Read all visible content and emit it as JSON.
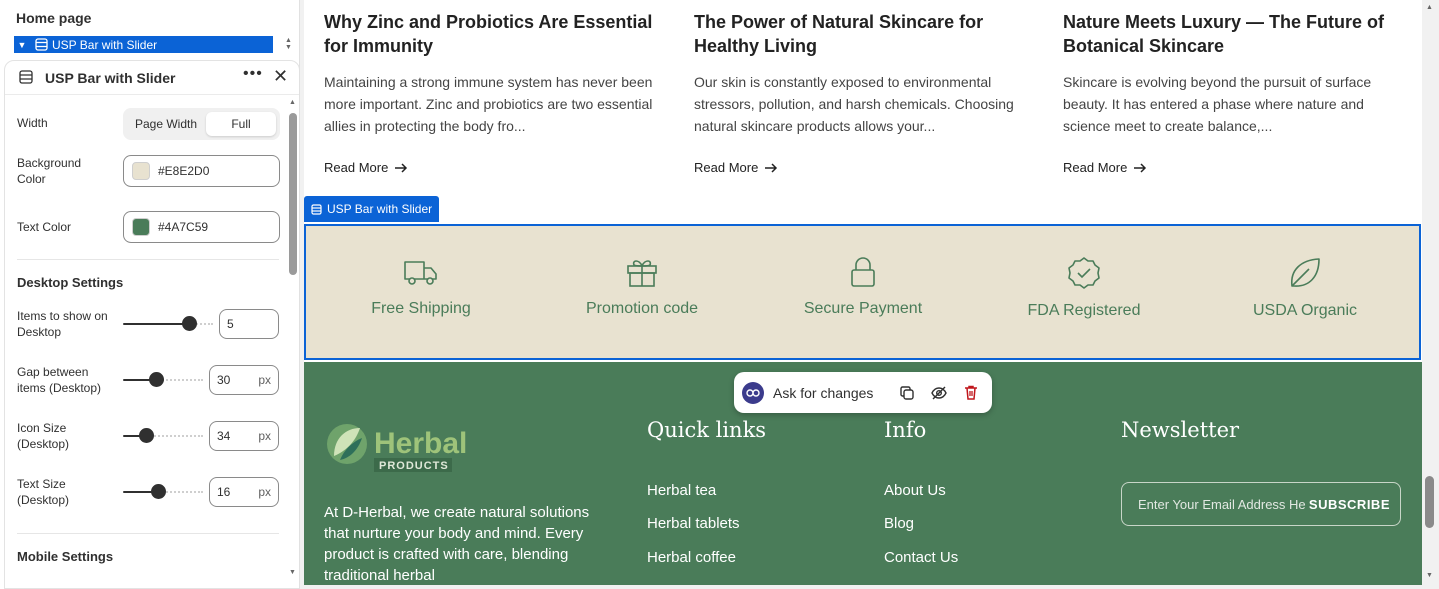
{
  "sidebar": {
    "page_title": "Home page",
    "selected_item": "USP Bar with Slider",
    "panel": {
      "title": "USP Bar with Slider",
      "width_label": "Width",
      "width_options": [
        "Page Width",
        "Full"
      ],
      "width_selected": "Full",
      "bg_color_label": "Background Color",
      "bg_color_value": "#E8E2D0",
      "text_color_label": "Text Color",
      "text_color_value": "#4A7C59",
      "desktop_section": "Desktop Settings",
      "items_desktop_label": "Items to show on Desktop",
      "items_desktop_value": "5",
      "gap_desktop_label": "Gap between items (Desktop)",
      "gap_desktop_value": "30",
      "icon_size_desktop_label": "Icon Size (Desktop)",
      "icon_size_desktop_value": "34",
      "text_size_desktop_label": "Text Size (Desktop)",
      "text_size_desktop_value": "16",
      "unit_px": "px",
      "mobile_section": "Mobile Settings"
    }
  },
  "preview": {
    "posts": [
      {
        "title": "Why Zinc and Probiotics Are Essential for Immunity",
        "excerpt": "Maintaining a strong immune system has never been more important. Zinc and probiotics are two essential allies in protecting the body fro...",
        "read_more": "Read More"
      },
      {
        "title": "The Power of Natural Skincare for Healthy Living",
        "excerpt": "Our skin is constantly exposed to environmental stressors, pollution, and harsh chemicals. Choosing natural skincare products allows your...",
        "read_more": "Read More"
      },
      {
        "title": "Nature Meets Luxury — The Future of Botanical Skincare",
        "excerpt": "Skincare is evolving beyond the pursuit of surface beauty. It has entered a phase where nature and science meet to create balance,...",
        "read_more": "Read More"
      }
    ],
    "section_tag": "USP Bar with Slider",
    "usp_items": [
      {
        "label": "Free Shipping",
        "icon": "truck-icon"
      },
      {
        "label": "Promotion code",
        "icon": "gift-icon"
      },
      {
        "label": "Secure Payment",
        "icon": "lock-icon"
      },
      {
        "label": "FDA Registered",
        "icon": "badge-check-icon"
      },
      {
        "label": "USDA Organic",
        "icon": "leaf-icon"
      }
    ],
    "ask_bar": {
      "label": "Ask for changes"
    },
    "footer": {
      "logo_text": "Herbal",
      "logo_sub": "PRODUCTS",
      "about": "At D-Herbal, we create natural solutions that nurture your body and mind. Every product is crafted with care, blending traditional herbal",
      "quick_links_title": "Quick links",
      "quick_links": [
        "Herbal tea",
        "Herbal tablets",
        "Herbal coffee"
      ],
      "info_title": "Info",
      "info_links": [
        "About Us",
        "Blog",
        "Contact Us"
      ],
      "newsletter_title": "Newsletter",
      "newsletter_placeholder": "Enter Your Email Address Here",
      "subscribe": "SUBSCRIBE"
    }
  },
  "colors": {
    "accent": "#0b63d6",
    "usp_bg": "#E8E2D0",
    "usp_text": "#4A7C59",
    "footer_bg": "#4A7C59"
  }
}
